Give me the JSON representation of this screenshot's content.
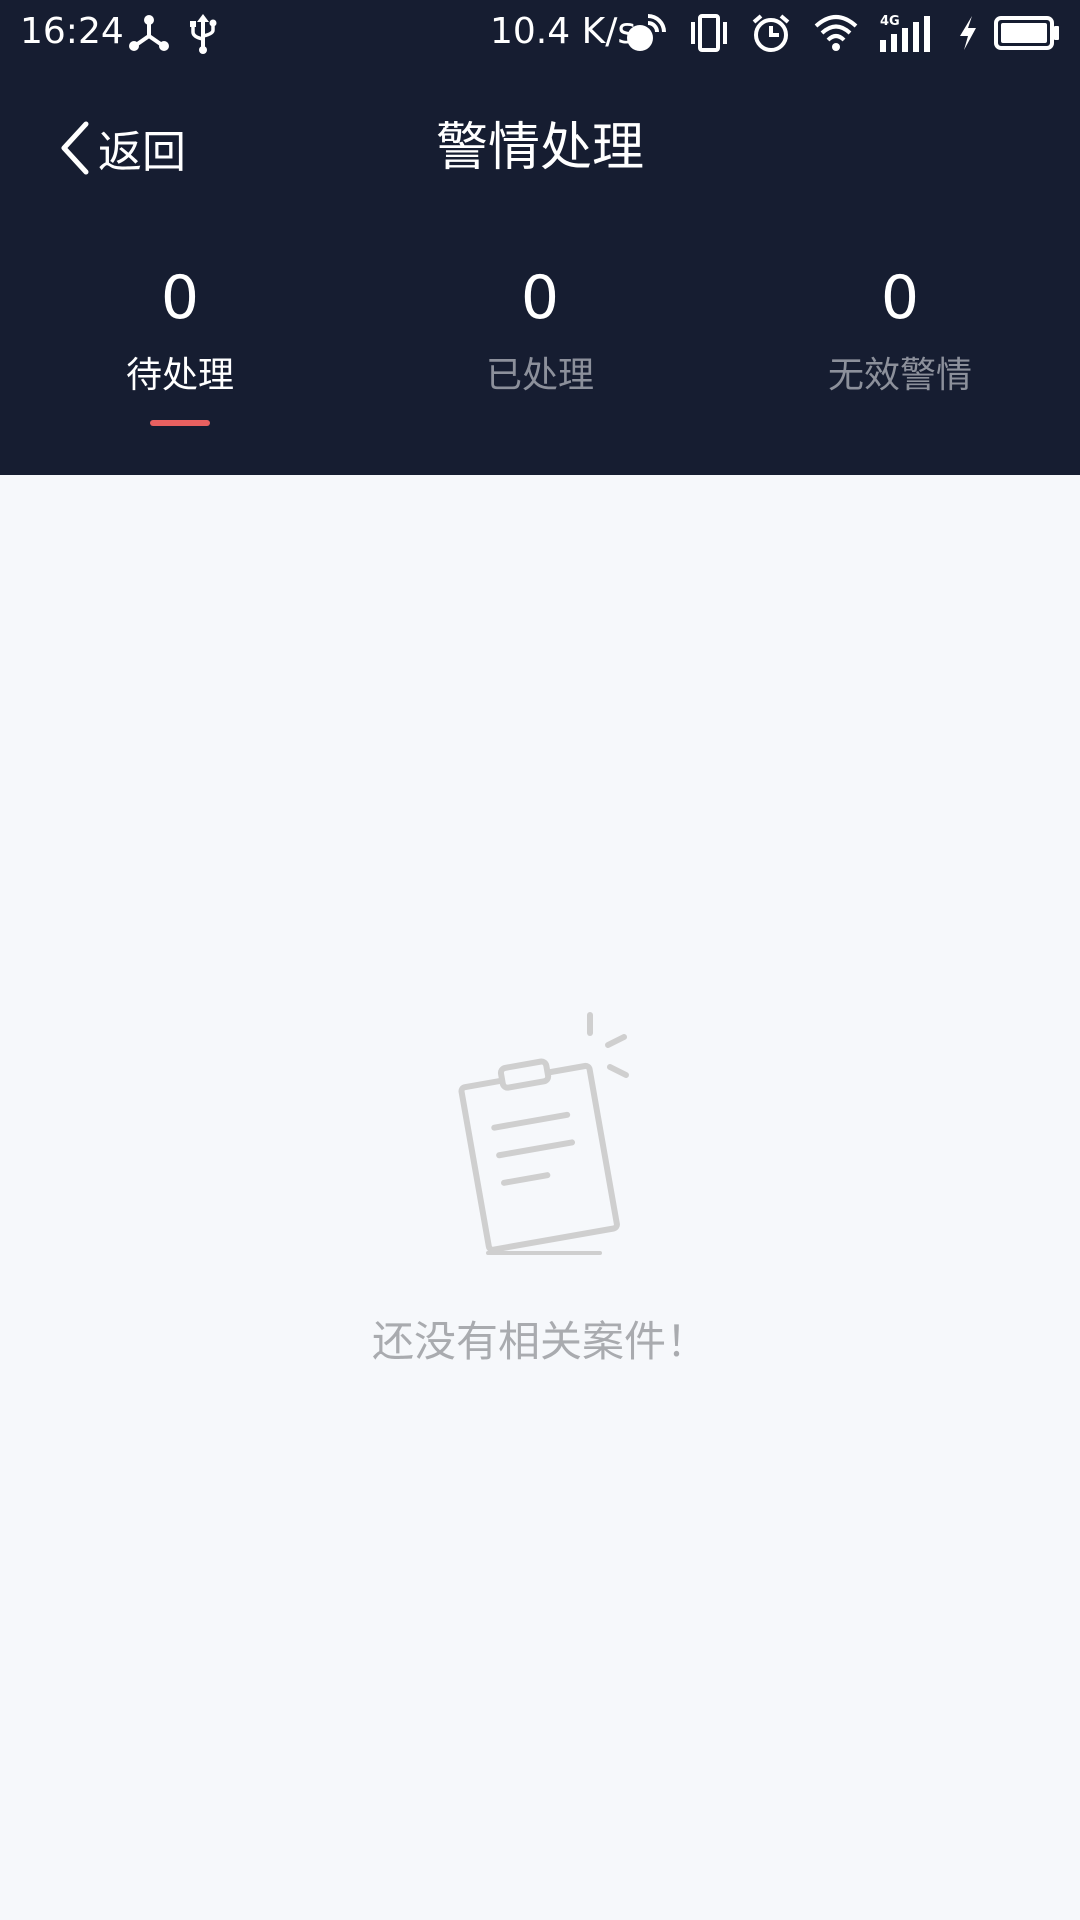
{
  "status_bar": {
    "time": "16:24",
    "network_speed": "10.4 K/s",
    "icons": [
      "share-hub-icon",
      "usb-icon",
      "hotspot-icon",
      "vibrate-icon",
      "alarm-icon",
      "wifi-icon",
      "signal-4g-icon",
      "charging-icon",
      "battery-icon"
    ],
    "signal_label": "4G"
  },
  "nav": {
    "back_label": "返回",
    "title": "警情处理"
  },
  "tabs": [
    {
      "count": "0",
      "label": "待处理",
      "active": true
    },
    {
      "count": "0",
      "label": "已处理",
      "active": false
    },
    {
      "count": "0",
      "label": "无效警情",
      "active": false
    }
  ],
  "empty_state": {
    "icon": "clipboard-icon",
    "message": "还没有相关案件！"
  },
  "colors": {
    "header_bg": "#161d31",
    "page_bg": "#f6f8fb",
    "accent": "#e86060",
    "inactive_tab": "#8c909b",
    "empty_text": "#a9abaf"
  }
}
